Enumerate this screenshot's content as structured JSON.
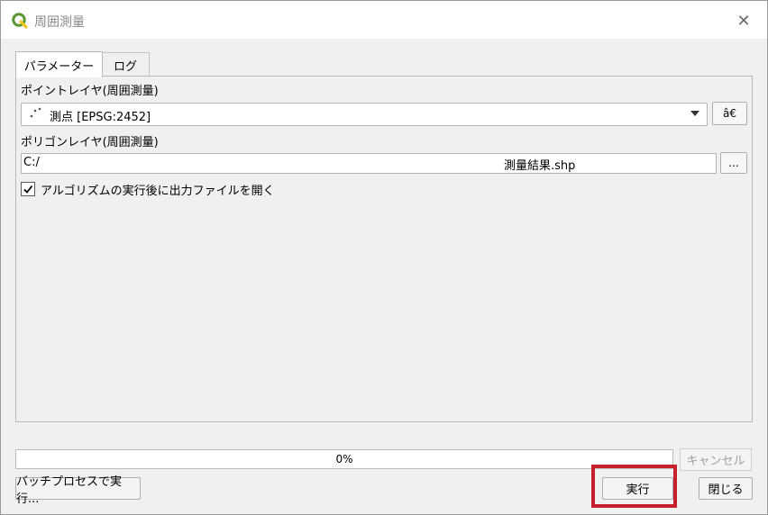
{
  "window": {
    "title": "周囲測量"
  },
  "tabs": [
    {
      "label": "パラメーター"
    },
    {
      "label": "ログ"
    }
  ],
  "params": {
    "point_layer_label": "ポイントレイヤ(周囲測量)",
    "point_layer_value": "測点 [EPSG:2452]",
    "iterate_glyph": "â€",
    "polygon_layer_label": "ポリゴンレイヤ(周囲測量)",
    "output_value_a": "C:/",
    "output_value_b": "測量結果.shp",
    "browse_label": "...",
    "open_after_label": "アルゴリズムの実行後に出力ファイルを開く",
    "open_after_checked": true
  },
  "progress": {
    "text": "0%",
    "fraction": 0.0
  },
  "buttons": {
    "cancel": "キャンセル",
    "batch": "バッチプロセスで実行...",
    "run": "実行",
    "close": "閉じる"
  },
  "colors": {
    "highlight": "#c8202a",
    "qgis_green": "#589632",
    "qgis_yellow": "#f0c419"
  }
}
